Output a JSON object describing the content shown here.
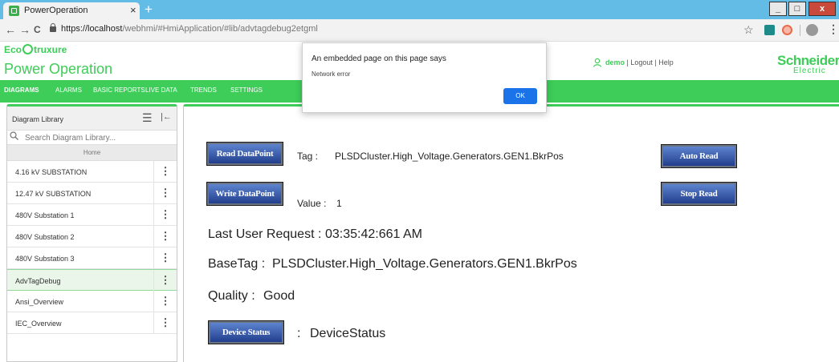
{
  "browser": {
    "tab_title": "PowerOperation",
    "tab_close": "×",
    "new_tab": "+",
    "url_host": "https://localhost",
    "url_rest": "/webhmi/#HmiApplication/#lib/advtagdebug2etgml",
    "back": "←",
    "forward": "→",
    "reload": "C",
    "star": "☆",
    "kebab": "⋮",
    "win_minimize": "_",
    "win_maximize": "□",
    "win_close": "x"
  },
  "header": {
    "brand_prefix": "Eco",
    "brand_suffix": "truxure",
    "product": "Power Operation",
    "user_name": "demo",
    "logout": "Logout",
    "help": "Help",
    "separator": "|",
    "logo_line1": "Schneider",
    "logo_line2": "Electric"
  },
  "menu": {
    "items": [
      "DIAGRAMS",
      "ALARMS",
      "BASIC REPORTS",
      "LIVE DATA",
      "TRENDS",
      "SETTINGS"
    ],
    "active": "DIAGRAMS"
  },
  "sidebar": {
    "title": "Diagram Library",
    "search_placeholder": "Search Diagram Library...",
    "home": "Home",
    "items": [
      {
        "label": "4.16 kV SUBSTATION"
      },
      {
        "label": "12.47 kV SUBSTATION"
      },
      {
        "label": "480V Substation 1"
      },
      {
        "label": "480V Substation 2"
      },
      {
        "label": "480V Substation 3"
      },
      {
        "label": "AdvTagDebug",
        "active": true
      },
      {
        "label": "Ansi_Overview"
      },
      {
        "label": "IEC_Overview"
      }
    ]
  },
  "main": {
    "read_button": "Read DataPoint",
    "write_button": "Write DataPoint",
    "auto_read_button": "Auto Read",
    "stop_read_button": "Stop Read",
    "tag_label": "Tag :",
    "tag_value": "PLSDCluster.High_Voltage.Generators.GEN1.BkrPos",
    "value_label": "Value :",
    "value_value": "1",
    "last_request_label": "Last User Request :",
    "last_request_value": "03:35:42:661 AM",
    "basetag_label": "BaseTag :",
    "basetag_value": "PLSDCluster.High_Voltage.Generators.GEN1.BkrPos",
    "quality_label": "Quality :",
    "quality_value": "Good",
    "device_status_button": "Device Status",
    "device_status_sep": ":",
    "device_status_value": "DeviceStatus"
  },
  "dialog": {
    "title": "An embedded page on this page says",
    "message": "Network error",
    "ok": "OK"
  },
  "colors": {
    "brand_green": "#3dcd58",
    "tabstrip_blue": "#63bce5",
    "button_blue": "#213e8c",
    "dialog_ok": "#1a73e8"
  }
}
